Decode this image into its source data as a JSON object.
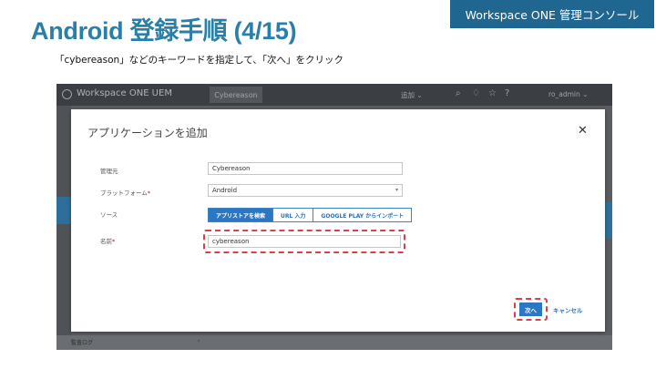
{
  "slide": {
    "title": "Android 登録手順 (4/15)",
    "tag": "Workspace ONE 管理コンソール",
    "instruction": "「cybereason」などのキーワードを指定して、「次へ」をクリック"
  },
  "console": {
    "brand": "Workspace ONE UEM",
    "search_chip": "Cybereason",
    "top_dropdown": "追加 ⌄",
    "user": "ro_admin ⌄",
    "bottom_row_label": "監査ログ"
  },
  "modal": {
    "title": "アプリケーションを追加",
    "fields": {
      "managed_by_label": "管理元",
      "managed_by_value": "Cybereason",
      "platform_label": "プラットフォーム",
      "platform_value": "Android",
      "source_label": "ソース",
      "name_label": "名前",
      "name_value": "cybereason"
    },
    "source_options": [
      "アプリストアを検索",
      "URL 入力",
      "GOOGLE PLAY からインポート"
    ],
    "required_mark": "*",
    "next_label": "次へ",
    "cancel_label": "キャンセル"
  },
  "colors": {
    "title_blue": "#2a7fa8",
    "tag_bg": "#1f6691",
    "accent": "#2a78c5",
    "highlight_dash": "#d9404a"
  }
}
